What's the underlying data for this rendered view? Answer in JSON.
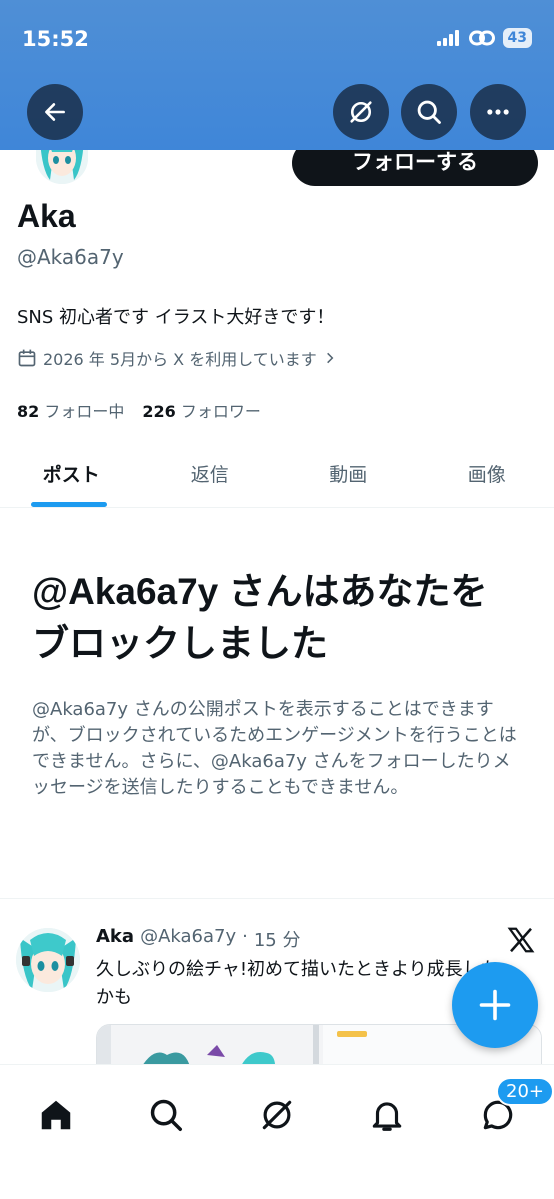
{
  "status_bar": {
    "time": "15:52",
    "battery": "43"
  },
  "header": {
    "follow_label": "フォローする"
  },
  "profile": {
    "name": "Aka",
    "handle": "@Aka6a7y",
    "bio": "SNS 初心者です イラスト大好きです！",
    "joined": "2026 年 5月から X を利用しています",
    "following_count": "82",
    "following_label": "フォロー中",
    "followers_count": "226",
    "followers_label": "フォロワー"
  },
  "tabs": [
    {
      "label": "ポスト",
      "active": true
    },
    {
      "label": "返信",
      "active": false
    },
    {
      "label": "動画",
      "active": false
    },
    {
      "label": "画像",
      "active": false
    }
  ],
  "blocked": {
    "title": "@Aka6a7y さんはあなたをブロックしました",
    "description": "@Aka6a7y さんの公開ポストを表示することはできますが、ブロックされているためエンゲージメントを行うことはできません。さらに、@Aka6a7y さんをフォローしたりメッセージを送信したりすることもできません。"
  },
  "post": {
    "name": "Aka",
    "handle": "@Aka6a7y",
    "separator": "·",
    "time": "15 分",
    "text": "久しぶりの絵チャ!初めて描いたときより成長したかも"
  },
  "bottom_nav": {
    "messages_badge": "20+"
  },
  "colors": {
    "accent": "#1d9bf0",
    "header": "#3f86d8",
    "text": "#0f1419",
    "secondary": "#536471"
  }
}
